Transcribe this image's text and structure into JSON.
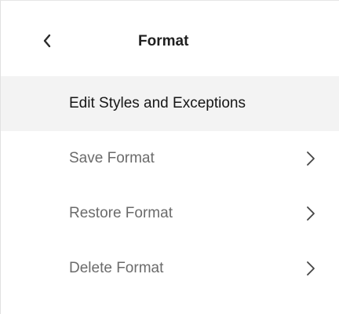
{
  "header": {
    "title": "Format",
    "back_icon": "chevron-left-icon"
  },
  "menu": {
    "items": [
      {
        "label": "Edit Styles and Exceptions",
        "has_submenu": false,
        "active": true
      },
      {
        "label": "Save Format",
        "has_submenu": true,
        "active": false,
        "icon": "chevron-right-icon"
      },
      {
        "label": "Restore Format",
        "has_submenu": true,
        "active": false,
        "icon": "chevron-right-icon"
      },
      {
        "label": "Delete Format",
        "has_submenu": true,
        "active": false,
        "icon": "chevron-right-icon"
      }
    ]
  },
  "colors": {
    "active_background": "#f3f3f3",
    "primary_text": "#161616",
    "secondary_text": "#6b6b6b",
    "icon": "#444444"
  }
}
